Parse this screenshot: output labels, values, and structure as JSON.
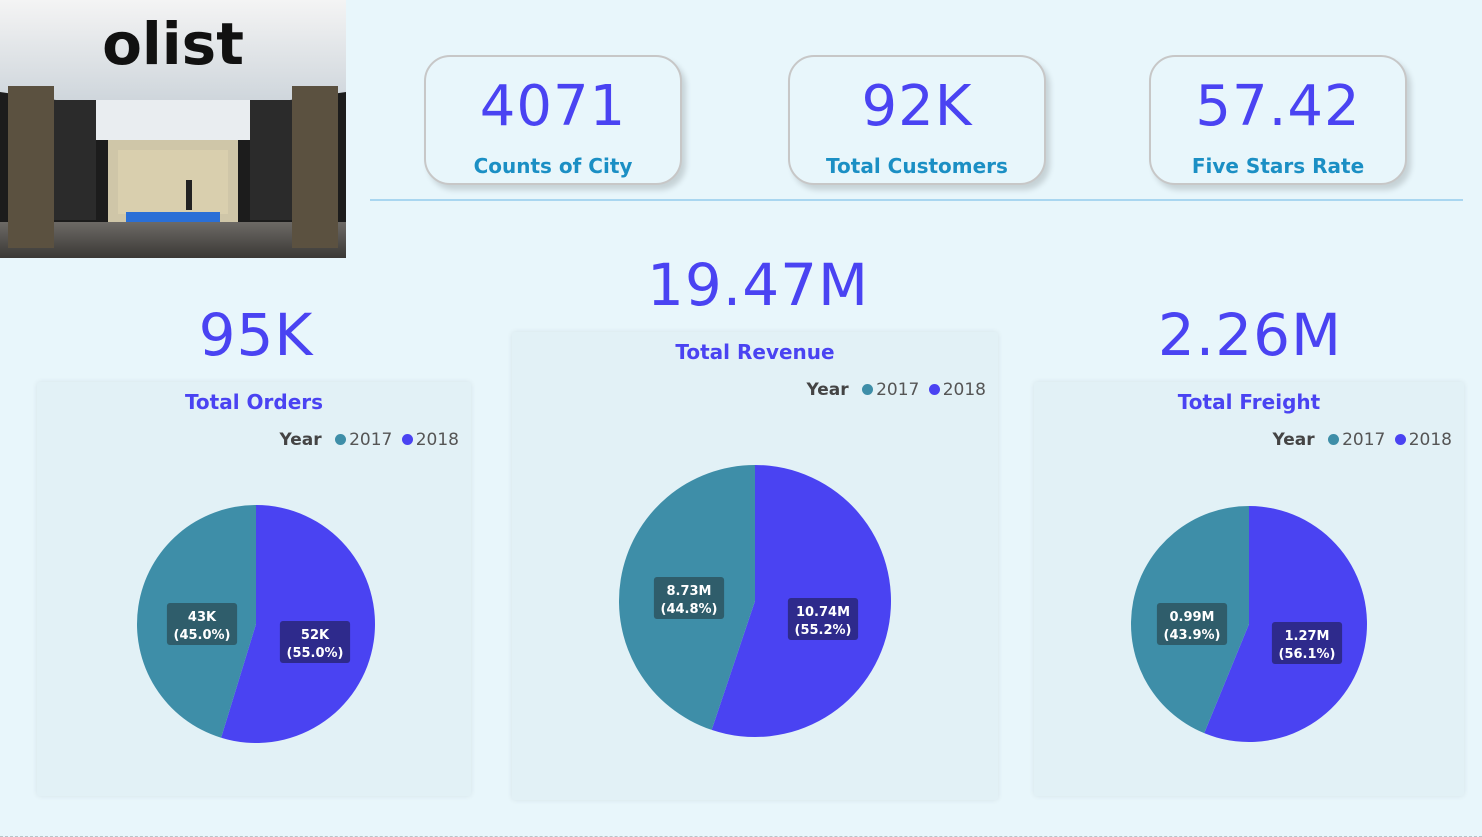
{
  "hero_image": {
    "logo_text": "olist"
  },
  "kpis": [
    {
      "value": "4071",
      "label": "Counts of City"
    },
    {
      "value": "92K",
      "label": "Total Customers"
    },
    {
      "value": "57.42",
      "label": "Five Stars Rate"
    }
  ],
  "colors": {
    "series_2017": "#3e8ea8",
    "series_2018": "#4a43f2",
    "accent": "#4a43f2"
  },
  "chart_data": [
    {
      "type": "pie",
      "big_value": "95K",
      "title": "Total Orders",
      "legend_title": "Year",
      "categories": [
        "2017",
        "2018"
      ],
      "values": [
        43,
        52
      ],
      "value_labels": [
        "43K",
        "52K"
      ],
      "percent_labels": [
        "(45.0%)",
        "(55.0%)"
      ],
      "percents": [
        45.0,
        55.0
      ]
    },
    {
      "type": "pie",
      "big_value": "19.47M",
      "title": "Total Revenue",
      "legend_title": "Year",
      "categories": [
        "2017",
        "2018"
      ],
      "values": [
        8.73,
        10.74
      ],
      "value_labels": [
        "8.73M",
        "10.74M"
      ],
      "percent_labels": [
        "(44.8%)",
        "(55.2%)"
      ],
      "percents": [
        44.8,
        55.2
      ]
    },
    {
      "type": "pie",
      "big_value": "2.26M",
      "title": "Total Freight",
      "legend_title": "Year",
      "categories": [
        "2017",
        "2018"
      ],
      "values": [
        0.99,
        1.27
      ],
      "value_labels": [
        "0.99M",
        "1.27M"
      ],
      "percent_labels": [
        "(43.9%)",
        "(56.1%)"
      ],
      "percents": [
        43.9,
        56.1
      ]
    }
  ]
}
